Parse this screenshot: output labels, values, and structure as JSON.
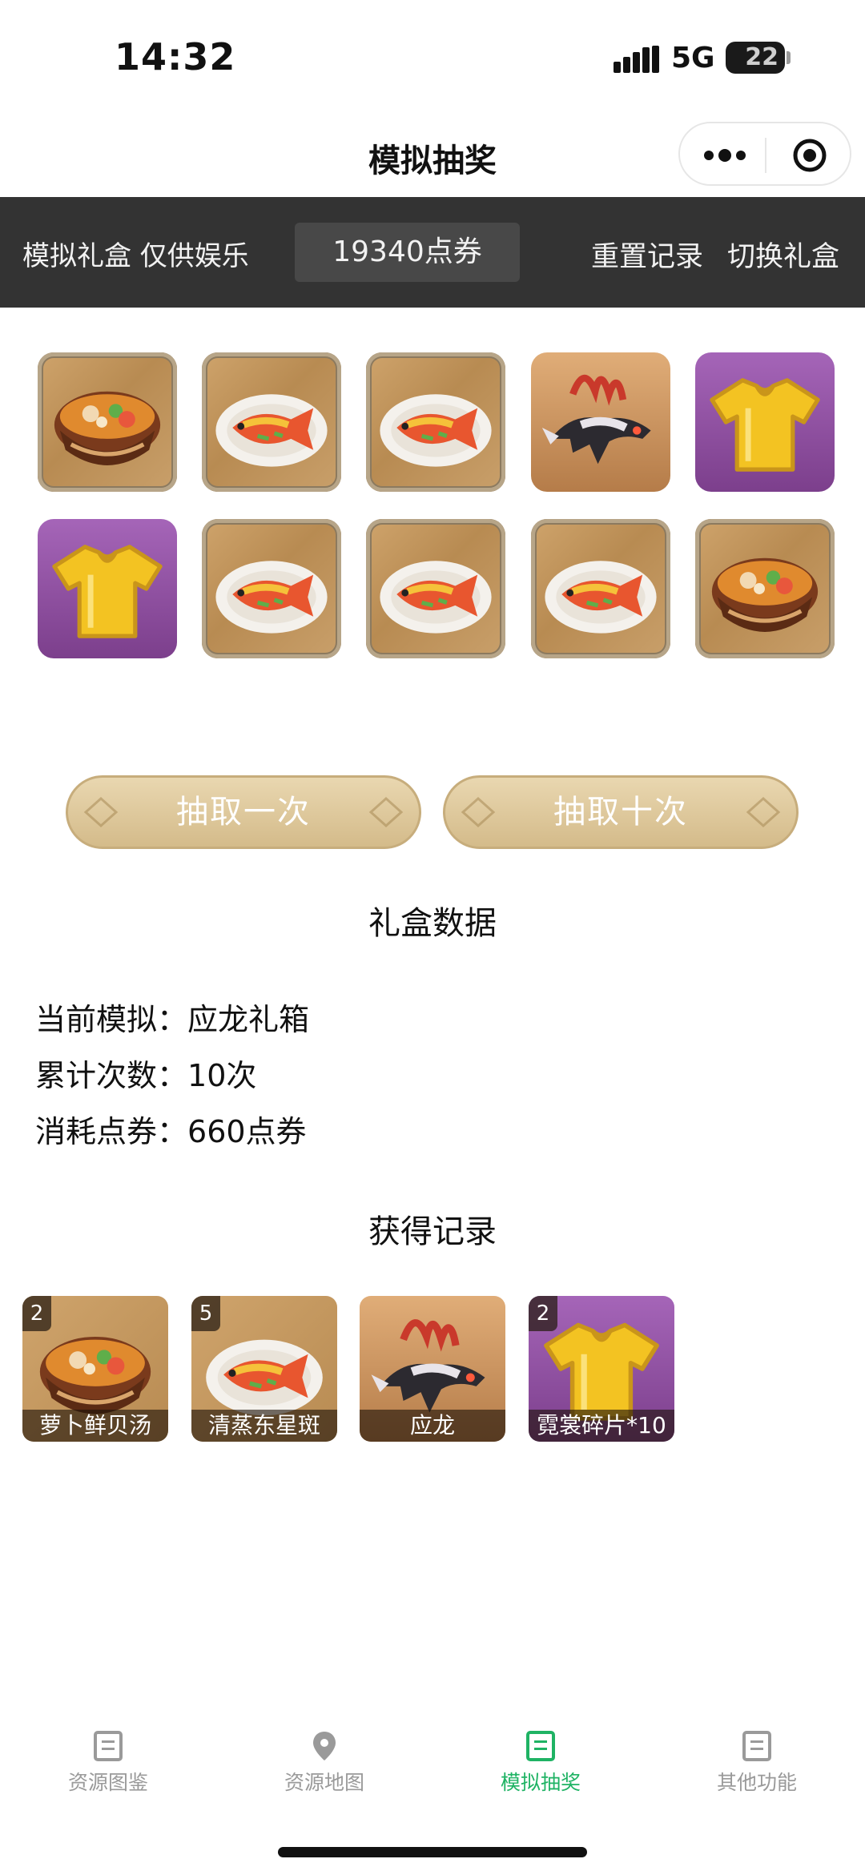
{
  "status_bar": {
    "time": "14:32",
    "network": "5G",
    "battery": "22"
  },
  "nav": {
    "title": "模拟抽奖"
  },
  "toolbar": {
    "left_label": "模拟礼盒 仅供娱乐",
    "points": "19340点券",
    "reset_label": "重置记录",
    "switch_label": "切换礼盒"
  },
  "grid_items": [
    {
      "icon": "soup-bowl-icon",
      "bg": "wood"
    },
    {
      "icon": "fish-plate-icon",
      "bg": "wood"
    },
    {
      "icon": "fish-plate-icon",
      "bg": "wood"
    },
    {
      "icon": "dragon-mount-icon",
      "bg": "dark"
    },
    {
      "icon": "golden-shirt-icon",
      "bg": "purple"
    },
    {
      "icon": "golden-shirt-icon",
      "bg": "purple"
    },
    {
      "icon": "fish-plate-icon",
      "bg": "wood"
    },
    {
      "icon": "fish-plate-icon",
      "bg": "wood"
    },
    {
      "icon": "fish-plate-icon",
      "bg": "wood"
    },
    {
      "icon": "soup-bowl-icon",
      "bg": "wood"
    }
  ],
  "buttons": {
    "draw_once": "抽取一次",
    "draw_ten": "抽取十次"
  },
  "stats": {
    "title": "礼盒数据",
    "current_label": "当前模拟：",
    "current_value": "应龙礼箱",
    "count_label": "累计次数：",
    "count_value": "10次",
    "cost_label": "消耗点券：",
    "cost_value": "660点券"
  },
  "records": {
    "title": "获得记录",
    "items": [
      {
        "name": "萝卜鲜贝汤",
        "count": "2",
        "icon": "soup-bowl-icon"
      },
      {
        "name": "清蒸东星斑",
        "count": "5",
        "icon": "fish-plate-icon"
      },
      {
        "name": "应龙",
        "count": "",
        "icon": "dragon-mount-icon"
      },
      {
        "name": "霓裳碎片*10",
        "count": "2",
        "icon": "golden-shirt-icon"
      }
    ]
  },
  "tabs": [
    {
      "label": "资源图鉴",
      "icon": "catalog-icon",
      "active": false
    },
    {
      "label": "资源地图",
      "icon": "map-pin-icon",
      "active": false
    },
    {
      "label": "模拟抽奖",
      "icon": "lottery-icon",
      "active": true
    },
    {
      "label": "其他功能",
      "icon": "more-functions-icon",
      "active": false
    }
  ],
  "colors": {
    "accent": "#1fb364",
    "toolbar_bg": "#333333",
    "button_gold": "#d9c394"
  }
}
